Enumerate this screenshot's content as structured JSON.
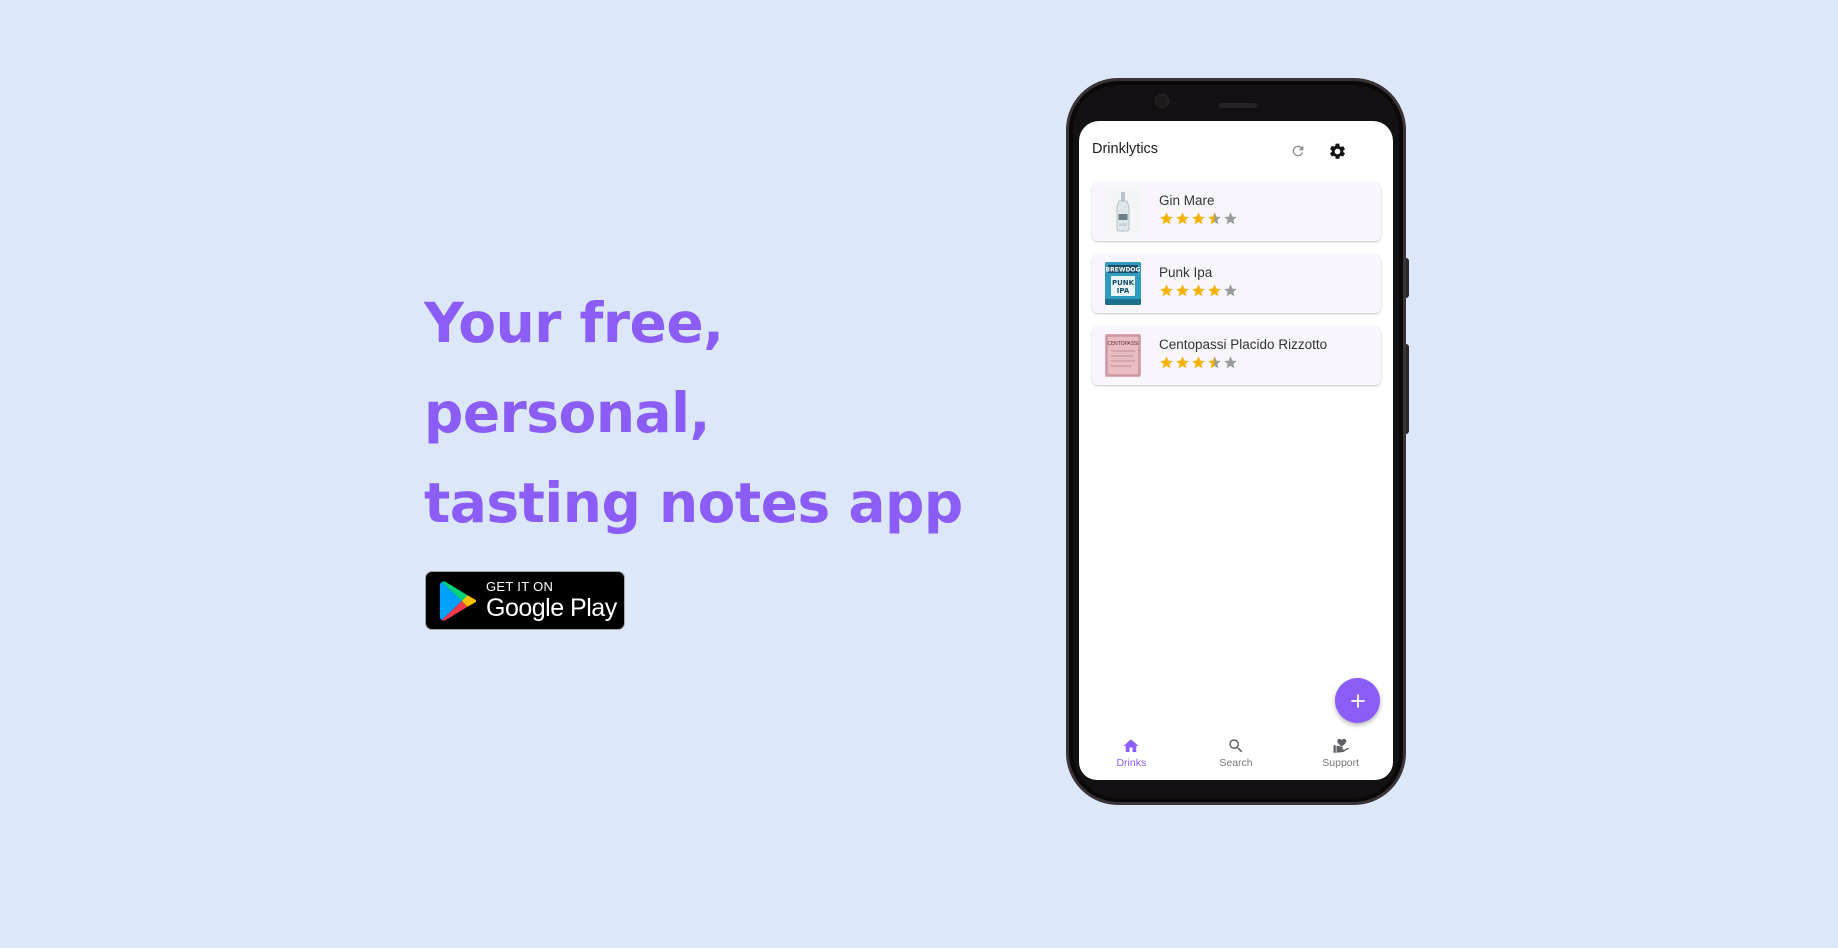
{
  "hero": {
    "lines": [
      "Your free,",
      "personal,",
      "tasting notes app"
    ]
  },
  "play_badge": {
    "small": "GET IT ON",
    "big": "Google Play"
  },
  "app": {
    "title": "Drinklytics",
    "drinks": [
      {
        "name": "Gin Mare",
        "rating": 3.5,
        "thumb": "gin-bottle"
      },
      {
        "name": "Punk Ipa",
        "rating": 4,
        "thumb": "punk-ipa-can"
      },
      {
        "name": "Centopassi Placido Rizzotto",
        "rating": 3.5,
        "thumb": "wine-label"
      }
    ],
    "nav": [
      {
        "label": "Drinks",
        "icon": "home-icon",
        "active": true
      },
      {
        "label": "Search",
        "icon": "search-icon",
        "active": false
      },
      {
        "label": "Support",
        "icon": "support-icon",
        "active": false
      }
    ]
  },
  "colors": {
    "background": "#dce8fa",
    "accent": "#8b5cf6",
    "star_filled": "#f5b301",
    "star_empty": "#9a9a9a"
  }
}
